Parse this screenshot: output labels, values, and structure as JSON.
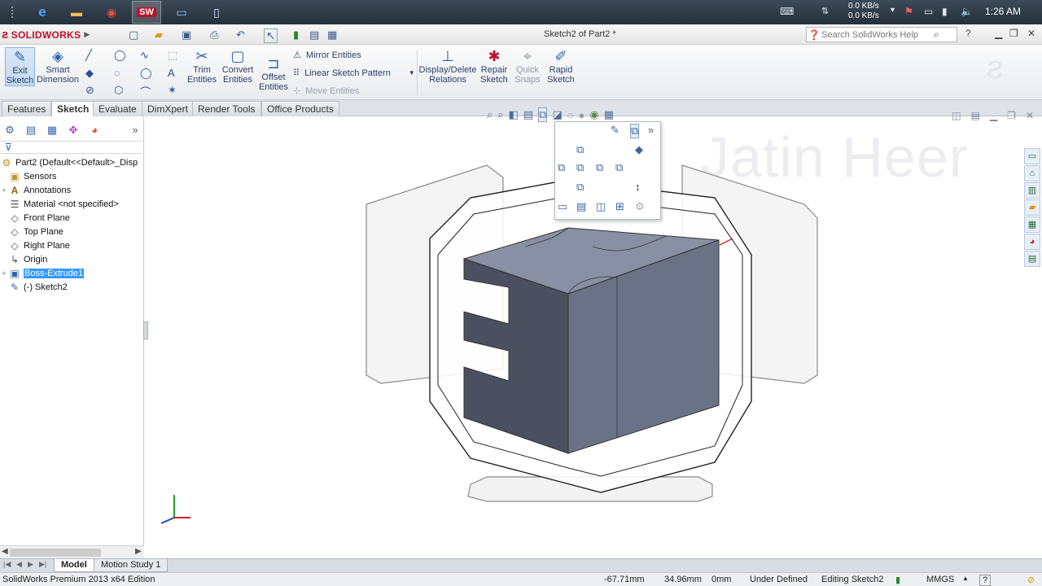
{
  "taskbar": {
    "net_up": "0.0 KB/s",
    "net_down": "0.0 KB/s",
    "clock": "1:26 AM"
  },
  "app": {
    "logo": "SOLIDWORKS",
    "document_title": "Sketch2 of Part2 *",
    "search_placeholder": "Search SolidWorks Help"
  },
  "ribbon": {
    "exit_sketch": "Exit Sketch",
    "smart_dimension": "Smart Dimension",
    "trim_entities": "Trim Entities",
    "convert_entities": "Convert Entities",
    "offset_entities": "Offset Entities",
    "mirror_entities": "Mirror Entities",
    "linear_sketch_pattern": "Linear Sketch Pattern",
    "move_entities": "Move Entities",
    "display_delete_relations": "Display/Delete Relations",
    "repair_sketch": "Repair Sketch",
    "quick_snaps": "Quick Snaps",
    "rapid_sketch": "Rapid Sketch"
  },
  "tabs": [
    "Features",
    "Sketch",
    "Evaluate",
    "DimXpert",
    "Render Tools",
    "Office Products"
  ],
  "active_tab": "Sketch",
  "tree": {
    "root": "Part2  (Default<<Default>_Disp",
    "items": [
      {
        "label": "Sensors",
        "icon": "sensor-icon"
      },
      {
        "label": "Annotations",
        "icon": "annotation-icon"
      },
      {
        "label": "Material <not specified>",
        "icon": "material-icon"
      },
      {
        "label": "Front Plane",
        "icon": "plane-icon"
      },
      {
        "label": "Top Plane",
        "icon": "plane-icon"
      },
      {
        "label": "Right Plane",
        "icon": "plane-icon"
      },
      {
        "label": "Origin",
        "icon": "origin-icon"
      },
      {
        "label": "Boss-Extrude1",
        "icon": "extrude-icon"
      },
      {
        "label": "(-) Sketch2",
        "icon": "sketch-icon"
      }
    ],
    "selected": "Boss-Extrude1"
  },
  "graphics": {
    "watermark": "Jatin Heer"
  },
  "bottom_tabs": [
    "Model",
    "Motion Study 1"
  ],
  "status": {
    "edition": "SolidWorks Premium 2013 x64 Edition",
    "x": "-67.71mm",
    "y": "34.96mm",
    "z": "0mm",
    "state": "Under Defined",
    "editing": "Editing Sketch2",
    "units": "MMGS",
    "help": "?"
  },
  "colors": {
    "part_face_dark": "#4b5060",
    "part_face_top": "#8a90a4",
    "part_face_side": "#6c7285",
    "accent": "#2d63b0"
  }
}
